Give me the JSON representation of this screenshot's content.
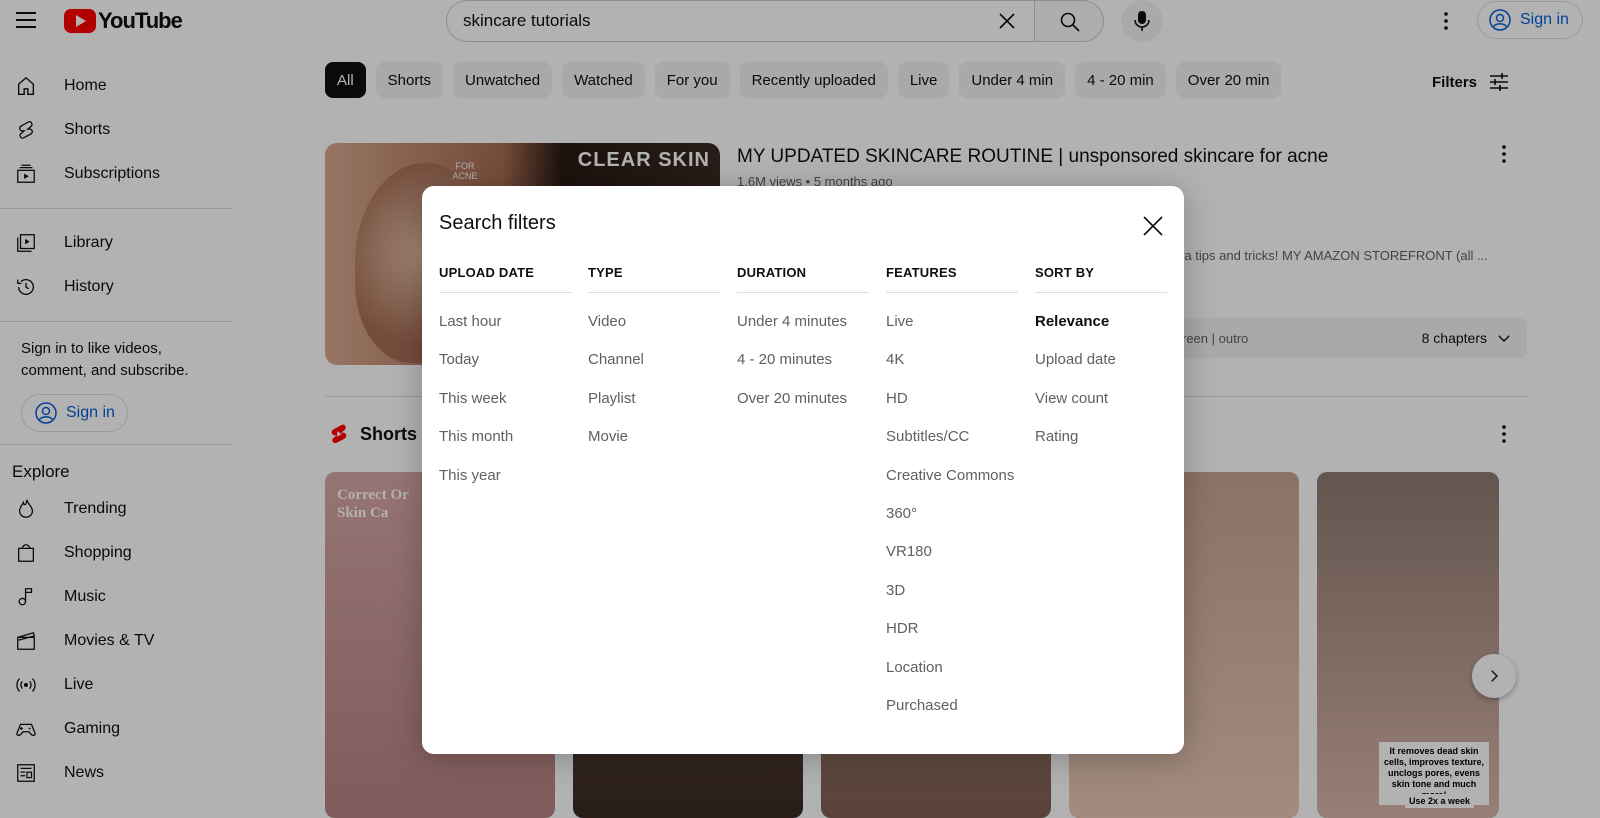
{
  "header": {
    "logo_text": "YouTube",
    "search_value": "skincare tutorials",
    "sign_in": "Sign in"
  },
  "sidebar": {
    "items": [
      {
        "label": "Home",
        "icon": "home-icon"
      },
      {
        "label": "Shorts",
        "icon": "shorts-icon"
      },
      {
        "label": "Subscriptions",
        "icon": "subscriptions-icon"
      }
    ],
    "library_items": [
      {
        "label": "Library",
        "icon": "library-icon"
      },
      {
        "label": "History",
        "icon": "history-icon"
      }
    ],
    "signin_message": "Sign in to like videos, comment, and subscribe.",
    "signin_button": "Sign in",
    "explore_title": "Explore",
    "explore_items": [
      {
        "label": "Trending",
        "icon": "trending-icon"
      },
      {
        "label": "Shopping",
        "icon": "shopping-icon"
      },
      {
        "label": "Music",
        "icon": "music-icon"
      },
      {
        "label": "Movies & TV",
        "icon": "movies-icon"
      },
      {
        "label": "Live",
        "icon": "live-icon"
      },
      {
        "label": "Gaming",
        "icon": "gaming-icon"
      },
      {
        "label": "News",
        "icon": "news-icon"
      }
    ]
  },
  "chips": [
    "All",
    "Shorts",
    "Unwatched",
    "Watched",
    "For you",
    "Recently uploaded",
    "Live",
    "Under 4 min",
    "4 - 20 min",
    "Over 20 min"
  ],
  "filters_label": "Filters",
  "video": {
    "title": "MY UPDATED SKINCARE ROUTINE | unsponsored skincare for acne",
    "views": "1.6M views",
    "age": "5 months ago",
    "description": "xtra tips and tricks! MY AMAZON STOREFRONT (all ...",
    "chapter_fragment": "reen | outro",
    "chapters": "8 chapters",
    "thumb_text": "CLEAR SKIN",
    "thumb_badge": "FOR ACNE"
  },
  "shorts": {
    "title": "Shorts",
    "short1_title": "Correct Or\nSkin Ca",
    "short5_caption": "It removes dead skin cells, improves texture, unclogs pores, evens skin tone and much more!",
    "short5_caption2": "Use 2x a week"
  },
  "dialog": {
    "title": "Search filters",
    "columns": [
      {
        "heading": "UPLOAD DATE",
        "options": [
          "Last hour",
          "Today",
          "This week",
          "This month",
          "This year"
        ]
      },
      {
        "heading": "TYPE",
        "options": [
          "Video",
          "Channel",
          "Playlist",
          "Movie"
        ]
      },
      {
        "heading": "DURATION",
        "options": [
          "Under 4 minutes",
          "4 - 20 minutes",
          "Over 20 minutes"
        ]
      },
      {
        "heading": "FEATURES",
        "options": [
          "Live",
          "4K",
          "HD",
          "Subtitles/CC",
          "Creative Commons",
          "360°",
          "VR180",
          "3D",
          "HDR",
          "Location",
          "Purchased"
        ]
      },
      {
        "heading": "SORT BY",
        "options": [
          "Relevance",
          "Upload date",
          "View count",
          "Rating"
        ],
        "selected": "Relevance"
      }
    ]
  },
  "colors": {
    "brand": "#ff0000",
    "link": "#065fd4",
    "chip_active": "#0f0f0f"
  }
}
